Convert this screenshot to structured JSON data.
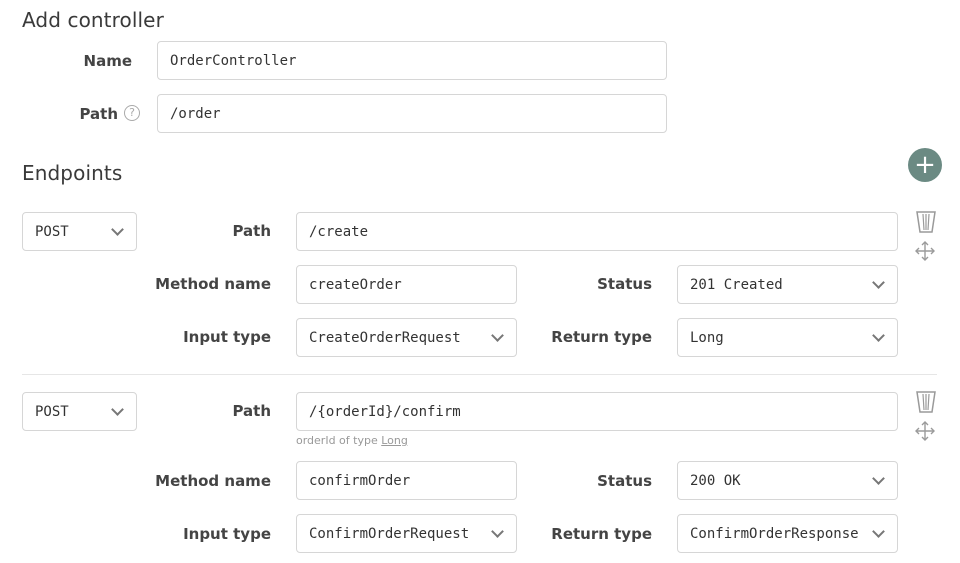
{
  "header": {
    "title": "Add controller"
  },
  "form": {
    "name_label": "Name",
    "name_value": "OrderController",
    "path_label": "Path",
    "path_help": "?",
    "path_value": "/order"
  },
  "endpoints": {
    "title": "Endpoints",
    "add_label": "+",
    "items": [
      {
        "method": "POST",
        "path_label": "Path",
        "path": "/create",
        "method_name_label": "Method name",
        "method_name": "createOrder",
        "status_label": "Status",
        "status": "201 Created",
        "input_type_label": "Input type",
        "input_type": "CreateOrderRequest",
        "return_type_label": "Return type",
        "return_type": "Long"
      },
      {
        "method": "POST",
        "path_label": "Path",
        "path": "/{orderId}/confirm",
        "path_hint_text": "orderId of type ",
        "path_hint_link": "Long",
        "method_name_label": "Method name",
        "method_name": "confirmOrder",
        "status_label": "Status",
        "status": "200 OK",
        "input_type_label": "Input type",
        "input_type": "ConfirmOrderRequest",
        "return_type_label": "Return type",
        "return_type": "ConfirmOrderResponse"
      }
    ]
  },
  "icons": {
    "delete": "trash-icon",
    "move": "move-icon",
    "help": "question-circle-icon"
  }
}
